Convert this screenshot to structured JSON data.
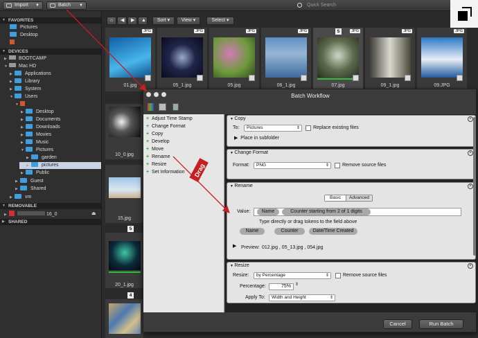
{
  "toolbar": {
    "import_label": "Import",
    "batch_label": "Batch",
    "search_placeholder": "Quick Search"
  },
  "sidebar": {
    "favorites_label": "FAVORITES",
    "favorites": [
      "Pictures",
      "Desktop"
    ],
    "devices_label": "DEVICES",
    "devices": [
      "BOOTCAMP",
      "Mac HD",
      "Applications",
      "Library",
      "System",
      "Users",
      "Desktop",
      "Documents",
      "Downloads",
      "Movies",
      "Music",
      "Pictures",
      "garden",
      "pictures",
      "Public",
      "Guest",
      "Shared",
      "vm"
    ],
    "removable_label": "REMOVABLE",
    "removable_item": "16_0",
    "shared_label": "SHARED"
  },
  "nav": {
    "sort_label": "Sort",
    "view_label": "View",
    "select_label": "Select"
  },
  "thumbs": [
    {
      "name": "01.jpg",
      "badge": "JPG",
      "color": "#1f7fc4"
    },
    {
      "name": "05_1.jpg",
      "badge": "JPG",
      "color": "#1a1a3a"
    },
    {
      "name": "05.jpg",
      "badge": "JPG",
      "color": "#7e5a8e"
    },
    {
      "name": "06_1.jpg",
      "badge": "JPG",
      "color": "#6a8fb8"
    },
    {
      "name": "07.jpg",
      "badge": "JPG",
      "color": "#4a5a3a"
    },
    {
      "name": "09_1.jpg",
      "badge": "JPG",
      "color": "#6a6a5a"
    },
    {
      "name": "09.JPG",
      "badge": "JPG",
      "color": "#2f7ec8"
    }
  ],
  "thumb_counts": {
    "selected": "5",
    "left_a": "5",
    "left_b": "4"
  },
  "left_thumbs": [
    "10_0.jpg",
    "15.jpg",
    "20_1.jpg"
  ],
  "dialog": {
    "title": "Batch Workflow",
    "actions": [
      "Adjust Time Stamp",
      "Change Format",
      "Copy",
      "Develop",
      "Move",
      "Rename",
      "Resize",
      "Set Information"
    ],
    "drag_label": "Drag",
    "copy": {
      "header": "Copy",
      "to_label": "To:",
      "to_value": "Pictures",
      "replace_label": "Replace existing files",
      "subfolder_label": "Place in subfolder"
    },
    "change_format": {
      "header": "Change Format",
      "format_label": "Format:",
      "format_value": "PNG",
      "remove_label": "Remove source files"
    },
    "rename": {
      "header": "Rename",
      "tab_basic": "Basic",
      "tab_advanced": "Advanced",
      "value_label": "Value:",
      "token_name": "Name",
      "token_counter": "Counter starting from 2 of 1 digits",
      "hint": "Type directly or drag tokens to the field above",
      "tokens": [
        "Name",
        "Counter",
        "Date/Time Created"
      ],
      "preview_label": "Preview:",
      "preview_value": "012.jpg , 05_13.jpg , 054.jpg"
    },
    "resize": {
      "header": "Resize",
      "resize_label": "Resize:",
      "resize_value": "by Percentage",
      "remove_label": "Remove source files",
      "percentage_label": "Percentage:",
      "percentage_value": "75%",
      "apply_label": "Apply To:",
      "apply_value": "Width and Height"
    },
    "cancel_label": "Cancel",
    "run_label": "Run Batch"
  }
}
